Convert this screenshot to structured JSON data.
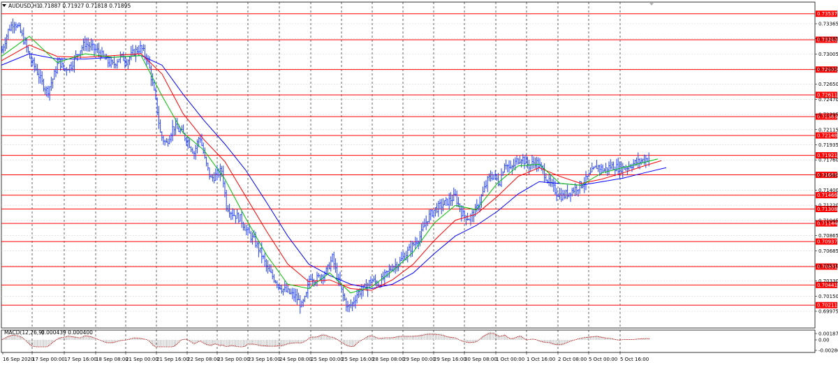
{
  "header": {
    "symbol_label": "AUDUSD,H1",
    "ohlc_text": "0.71887 0.71927 0.71818 0.71895"
  },
  "macd": {
    "label": "MACD(12,26,9)",
    "values_text": "0.000439 0.000400",
    "y_ticks": [
      "0.001878",
      "0.00",
      "-0.002864"
    ]
  },
  "colors": {
    "candle": "#1e3dff",
    "level_line": "#ff0000",
    "level_label_bg": "#ff0000",
    "ma_fast": "#00c000",
    "ma_mid": "#ff0000",
    "ma_slow": "#0000ff",
    "grid": "#d0d0d0",
    "macd_signal": "#c00000",
    "macd_hist": "#b0b0b0"
  },
  "chart_data": {
    "type": "candlestick",
    "symbol": "AUDUSD",
    "timeframe": "H1",
    "ylim": [
      0.6995,
      0.7367
    ],
    "y_ticks": [
      "0.73365",
      "0.73185",
      "0.73005",
      "0.72830",
      "0.72650",
      "0.72470",
      "0.72295",
      "0.72115",
      "0.71935",
      "0.71760",
      "0.71580",
      "0.71400",
      "0.71220",
      "0.71045",
      "0.70865",
      "0.70685",
      "0.70510",
      "0.70330",
      "0.70150",
      "0.69975"
    ],
    "x_labels": [
      "16 Sep 2020",
      "17 Sep 00:00",
      "17 Sep 16:00",
      "18 Sep 08:00",
      "21 Sep 00:00",
      "21 Sep 16:00",
      "22 Sep 08:00",
      "23 Sep 00:00",
      "23 Sep 16:00",
      "24 Sep 08:00",
      "25 Sep 00:00",
      "25 Sep 16:00",
      "28 Sep 08:00",
      "29 Sep 00:00",
      "29 Sep 16:00",
      "30 Sep 08:00",
      "1 Oct 00:00",
      "1 Oct 16:00",
      "2 Oct 08:00",
      "5 Oct 00:00",
      "5 Oct 16:00"
    ],
    "levels": [
      {
        "value": 0.73537,
        "label": "0.73537"
      },
      {
        "value": 0.7324,
        "label": "0.73240"
      },
      {
        "value": 0.729,
        "label": "0.72900"
      },
      {
        "value": 0.72611,
        "label": "0.72611"
      },
      {
        "value": 0.72363,
        "label": "0.72363"
      },
      {
        "value": 0.72148,
        "label": "0.72148"
      },
      {
        "value": 0.71921,
        "label": "0.71921"
      },
      {
        "value": 0.71698,
        "label": "0.71698"
      },
      {
        "value": 0.71466,
        "label": "0.71466"
      },
      {
        "value": 0.71308,
        "label": "0.71308"
      },
      {
        "value": 0.71144,
        "label": "0.71144"
      },
      {
        "value": 0.70937,
        "label": "0.70937"
      },
      {
        "value": 0.70651,
        "label": "0.70651"
      },
      {
        "value": 0.70441,
        "label": "0.70441"
      },
      {
        "value": 0.70211,
        "label": "0.70211"
      }
    ],
    "current_price": "0.71895",
    "price_path": [
      [
        0,
        0.731
      ],
      [
        10,
        0.7335
      ],
      [
        18,
        0.7345
      ],
      [
        26,
        0.7335
      ],
      [
        34,
        0.732
      ],
      [
        42,
        0.73
      ],
      [
        50,
        0.729
      ],
      [
        58,
        0.7275
      ],
      [
        66,
        0.7265
      ],
      [
        74,
        0.728
      ],
      [
        82,
        0.73
      ],
      [
        90,
        0.729
      ],
      [
        100,
        0.7295
      ],
      [
        110,
        0.731
      ],
      [
        120,
        0.732
      ],
      [
        130,
        0.7315
      ],
      [
        140,
        0.731
      ],
      [
        150,
        0.73
      ],
      [
        160,
        0.7295
      ],
      [
        170,
        0.7305
      ],
      [
        180,
        0.73
      ],
      [
        190,
        0.731
      ],
      [
        200,
        0.7315
      ],
      [
        210,
        0.73
      ],
      [
        216,
        0.7275
      ],
      [
        222,
        0.725
      ],
      [
        228,
        0.7215
      ],
      [
        236,
        0.7205
      ],
      [
        246,
        0.7225
      ],
      [
        256,
        0.722
      ],
      [
        266,
        0.721
      ],
      [
        276,
        0.7195
      ],
      [
        284,
        0.7215
      ],
      [
        292,
        0.7185
      ],
      [
        300,
        0.7165
      ],
      [
        308,
        0.717
      ],
      [
        316,
        0.7175
      ],
      [
        322,
        0.7135
      ],
      [
        332,
        0.7125
      ],
      [
        342,
        0.712
      ],
      [
        352,
        0.7105
      ],
      [
        362,
        0.7095
      ],
      [
        372,
        0.708
      ],
      [
        382,
        0.706
      ],
      [
        392,
        0.705
      ],
      [
        402,
        0.704
      ],
      [
        412,
        0.7035
      ],
      [
        422,
        0.703
      ],
      [
        430,
        0.702
      ],
      [
        436,
        0.703
      ],
      [
        442,
        0.7055
      ],
      [
        450,
        0.705
      ],
      [
        458,
        0.7055
      ],
      [
        466,
        0.706
      ],
      [
        474,
        0.7075
      ],
      [
        482,
        0.705
      ],
      [
        490,
        0.703
      ],
      [
        496,
        0.7018
      ],
      [
        502,
        0.7022
      ],
      [
        510,
        0.7035
      ],
      [
        520,
        0.704
      ],
      [
        530,
        0.705
      ],
      [
        540,
        0.7045
      ],
      [
        550,
        0.7055
      ],
      [
        560,
        0.7065
      ],
      [
        570,
        0.707
      ],
      [
        580,
        0.708
      ],
      [
        590,
        0.709
      ],
      [
        600,
        0.71
      ],
      [
        610,
        0.712
      ],
      [
        620,
        0.713
      ],
      [
        630,
        0.7135
      ],
      [
        640,
        0.714
      ],
      [
        650,
        0.7145
      ],
      [
        660,
        0.7125
      ],
      [
        670,
        0.712
      ],
      [
        680,
        0.713
      ],
      [
        690,
        0.715
      ],
      [
        697,
        0.7165
      ],
      [
        705,
        0.717
      ],
      [
        713,
        0.716
      ],
      [
        721,
        0.7185
      ],
      [
        729,
        0.7175
      ],
      [
        737,
        0.7185
      ],
      [
        745,
        0.719
      ],
      [
        755,
        0.718
      ],
      [
        765,
        0.7185
      ],
      [
        775,
        0.7175
      ],
      [
        785,
        0.716
      ],
      [
        795,
        0.715
      ],
      [
        803,
        0.7145
      ],
      [
        813,
        0.715
      ],
      [
        823,
        0.7155
      ],
      [
        833,
        0.716
      ],
      [
        843,
        0.717
      ],
      [
        853,
        0.718
      ],
      [
        863,
        0.7175
      ],
      [
        873,
        0.718
      ],
      [
        883,
        0.7178
      ],
      [
        893,
        0.7178
      ],
      [
        903,
        0.7182
      ],
      [
        913,
        0.7185
      ],
      [
        923,
        0.7188
      ],
      [
        931,
        0.71895
      ]
    ],
    "ma_fast": [
      [
        0,
        0.7305
      ],
      [
        40,
        0.7328
      ],
      [
        80,
        0.7298
      ],
      [
        120,
        0.7308
      ],
      [
        160,
        0.7304
      ],
      [
        200,
        0.7306
      ],
      [
        230,
        0.726
      ],
      [
        260,
        0.7218
      ],
      [
        290,
        0.7198
      ],
      [
        320,
        0.7165
      ],
      [
        350,
        0.712
      ],
      [
        380,
        0.7078
      ],
      [
        410,
        0.7045
      ],
      [
        440,
        0.704
      ],
      [
        470,
        0.7058
      ],
      [
        500,
        0.7035
      ],
      [
        530,
        0.7042
      ],
      [
        560,
        0.706
      ],
      [
        590,
        0.7082
      ],
      [
        620,
        0.7115
      ],
      [
        650,
        0.7135
      ],
      [
        680,
        0.713
      ],
      [
        710,
        0.716
      ],
      [
        740,
        0.718
      ],
      [
        770,
        0.7182
      ],
      [
        800,
        0.716
      ],
      [
        830,
        0.7158
      ],
      [
        860,
        0.7172
      ],
      [
        890,
        0.7178
      ],
      [
        920,
        0.7184
      ],
      [
        940,
        0.7188
      ]
    ],
    "ma_mid": [
      [
        0,
        0.73
      ],
      [
        40,
        0.7318
      ],
      [
        80,
        0.7305
      ],
      [
        120,
        0.7304
      ],
      [
        160,
        0.7306
      ],
      [
        200,
        0.7308
      ],
      [
        230,
        0.7285
      ],
      [
        260,
        0.724
      ],
      [
        290,
        0.721
      ],
      [
        320,
        0.7185
      ],
      [
        350,
        0.7145
      ],
      [
        380,
        0.7105
      ],
      [
        410,
        0.7068
      ],
      [
        440,
        0.7048
      ],
      [
        470,
        0.705
      ],
      [
        500,
        0.704
      ],
      [
        530,
        0.7038
      ],
      [
        560,
        0.705
      ],
      [
        590,
        0.7068
      ],
      [
        620,
        0.7095
      ],
      [
        650,
        0.7118
      ],
      [
        680,
        0.7125
      ],
      [
        710,
        0.7145
      ],
      [
        740,
        0.7168
      ],
      [
        770,
        0.7178
      ],
      [
        800,
        0.7168
      ],
      [
        830,
        0.716
      ],
      [
        860,
        0.7165
      ],
      [
        890,
        0.7172
      ],
      [
        920,
        0.718
      ],
      [
        945,
        0.7186
      ]
    ],
    "ma_slow": [
      [
        0,
        0.7295
      ],
      [
        40,
        0.7308
      ],
      [
        80,
        0.7302
      ],
      [
        120,
        0.7302
      ],
      [
        160,
        0.7304
      ],
      [
        200,
        0.7306
      ],
      [
        230,
        0.7295
      ],
      [
        260,
        0.7262
      ],
      [
        290,
        0.7232
      ],
      [
        320,
        0.7205
      ],
      [
        350,
        0.7175
      ],
      [
        380,
        0.7138
      ],
      [
        410,
        0.71
      ],
      [
        440,
        0.7068
      ],
      [
        470,
        0.7055
      ],
      [
        500,
        0.7045
      ],
      [
        530,
        0.704
      ],
      [
        560,
        0.7045
      ],
      [
        590,
        0.7058
      ],
      [
        620,
        0.708
      ],
      [
        650,
        0.71
      ],
      [
        680,
        0.7112
      ],
      [
        710,
        0.7128
      ],
      [
        740,
        0.7148
      ],
      [
        770,
        0.7162
      ],
      [
        800,
        0.716
      ],
      [
        830,
        0.7158
      ],
      [
        860,
        0.7162
      ],
      [
        890,
        0.7166
      ],
      [
        920,
        0.7172
      ],
      [
        952,
        0.7178
      ]
    ]
  }
}
